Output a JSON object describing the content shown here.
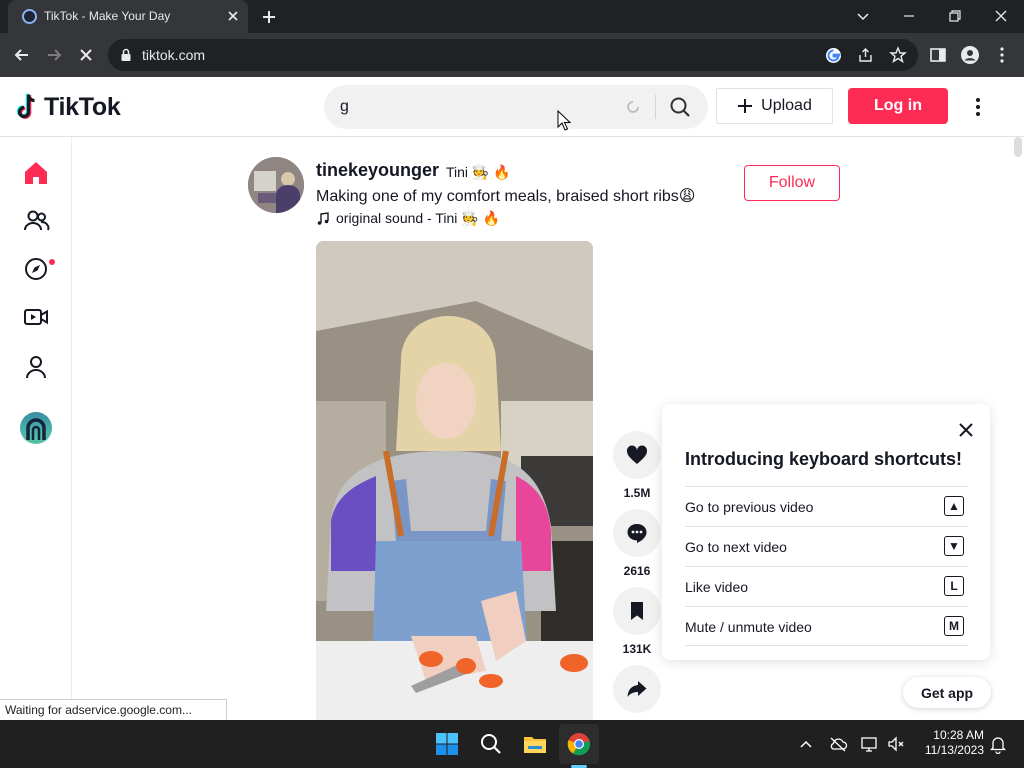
{
  "browser": {
    "tab_title": "TikTok - Make Your Day",
    "url": "tiktok.com",
    "status_text": "Waiting for adservice.google.com..."
  },
  "header": {
    "logo_text": "TikTok",
    "search_value": "g",
    "upload_label": "Upload",
    "login_label": "Log in"
  },
  "post": {
    "username": "tinekeyounger",
    "nickname": "Tini 🧑‍🍳 🔥",
    "caption": "Making one of my comfort meals, braised short ribs😩",
    "sound": "original sound - Tini 🧑‍🍳 🔥",
    "follow_label": "Follow",
    "likes": "1.5M",
    "comments": "2616",
    "saves": "131K"
  },
  "shortcuts": {
    "title": "Introducing keyboard shortcuts!",
    "items": [
      {
        "label": "Go to previous video",
        "key": "▲"
      },
      {
        "label": "Go to next video",
        "key": "▼"
      },
      {
        "label": "Like video",
        "key": "L"
      },
      {
        "label": "Mute / unmute video",
        "key": "M"
      }
    ]
  },
  "get_app_label": "Get app",
  "taskbar": {
    "time": "10:28 AM",
    "date": "11/13/2023"
  },
  "colors": {
    "brand": "#fe2c55",
    "chrome_dark": "#202124",
    "chrome_toolbar": "#35363a"
  }
}
